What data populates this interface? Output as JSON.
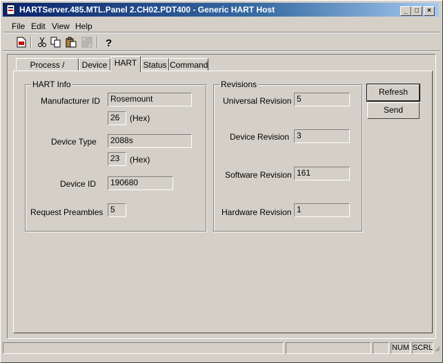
{
  "window": {
    "title": "HARTServer.485.MTL.Panel 2.CH02.PDT400 - Generic HART Host"
  },
  "titlebar_buttons": {
    "minimize": "_",
    "maximize": "□",
    "close": "×"
  },
  "menu": {
    "file": "File",
    "edit": "Edit",
    "view": "View",
    "help": "Help"
  },
  "toolbar": {
    "icons": [
      "document-icon",
      "cut-icon",
      "copy-icon",
      "paste-icon",
      "print-icon",
      "help-icon"
    ]
  },
  "tabs": [
    "Process / Output",
    "Device",
    "HART",
    "Status",
    "Command"
  ],
  "active_tab": "HART",
  "hart_info": {
    "group_label": "HART Info",
    "manufacturer_id_label": "Manufacturer ID",
    "manufacturer_id_value": "Rosemount",
    "manufacturer_hex_value": "26",
    "hex_label": "(Hex)",
    "device_type_label": "Device Type",
    "device_type_value": "2088s",
    "device_type_hex_value": "23",
    "device_id_label": "Device ID",
    "device_id_value": "190680",
    "request_preambles_label": "Request Preambles",
    "request_preambles_value": "5"
  },
  "revisions": {
    "group_label": "Revisions",
    "universal_label": "Universal Revision",
    "universal_value": "5",
    "device_label": "Device Revision",
    "device_value": "3",
    "software_label": "Software Revision",
    "software_value": "161",
    "hardware_label": "Hardware Revision",
    "hardware_value": "1"
  },
  "buttons": {
    "refresh": "Refresh",
    "send": "Send"
  },
  "statusbar": {
    "num": "NUM",
    "scrl": "SCRL"
  }
}
